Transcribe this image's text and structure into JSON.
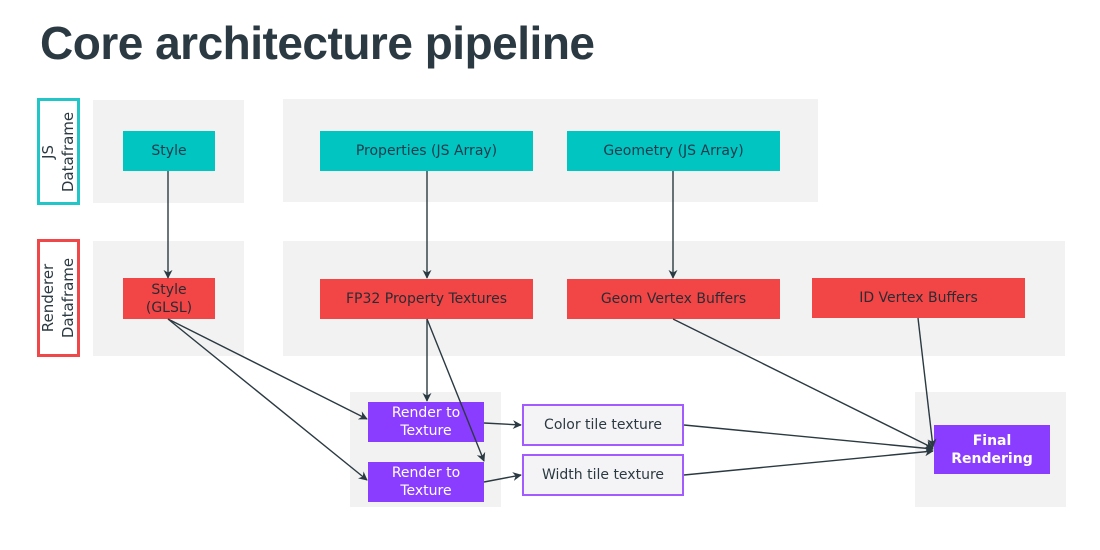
{
  "title": "Core architecture pipeline",
  "rows": [
    {
      "label": "JS\nDataframe",
      "color": "#22c5c8"
    },
    {
      "label": "Renderer\nDataframe",
      "color": "#f04848"
    }
  ],
  "nodes": {
    "style_js": "Style",
    "properties_js": "Properties (JS Array)",
    "geometry_js": "Geometry (JS Array)",
    "style_glsl": "Style\n(GLSL)",
    "fp32_textures": "FP32 Property Textures",
    "geom_buffers": "Geom Vertex Buffers",
    "id_buffers": "ID Vertex Buffers",
    "render_to_texture_1": "Render to\nTexture",
    "render_to_texture_2": "Render to\nTexture",
    "color_tile_texture": "Color tile texture",
    "width_tile_texture": "Width tile texture",
    "final_rendering": "Final\nRendering"
  },
  "edges": [
    [
      "style_js",
      "style_glsl"
    ],
    [
      "properties_js",
      "fp32_textures"
    ],
    [
      "geometry_js",
      "geom_buffers"
    ],
    [
      "style_glsl",
      "render_to_texture_1"
    ],
    [
      "style_glsl",
      "render_to_texture_2"
    ],
    [
      "fp32_textures",
      "render_to_texture_1"
    ],
    [
      "fp32_textures",
      "render_to_texture_2"
    ],
    [
      "render_to_texture_1",
      "color_tile_texture"
    ],
    [
      "render_to_texture_2",
      "width_tile_texture"
    ],
    [
      "color_tile_texture",
      "final_rendering"
    ],
    [
      "width_tile_texture",
      "final_rendering"
    ],
    [
      "geom_buffers",
      "final_rendering"
    ],
    [
      "id_buffers",
      "final_rendering"
    ]
  ],
  "colors": {
    "teal": "#00c5c0",
    "red": "#f24646",
    "purple": "#8b3dff",
    "edge": "#2b3a42"
  }
}
